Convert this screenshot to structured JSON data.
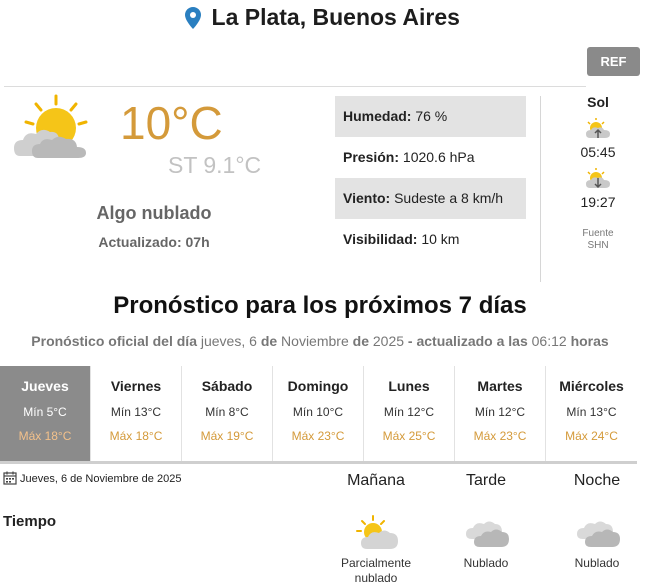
{
  "location": {
    "city": "La Plata, Buenos Aires",
    "icon": "map-pin-icon"
  },
  "ref_button": {
    "label": "REF"
  },
  "current": {
    "icon": "partly-cloudy-icon",
    "temperature": "10°C",
    "feels_like": "ST 9.1°C",
    "description": "Algo nublado",
    "updated": "Actualizado: 07h"
  },
  "details": [
    {
      "label": "Humedad:",
      "value": "76 %"
    },
    {
      "label": "Presión:",
      "value": "1020.6 hPa"
    },
    {
      "label": "Viento:",
      "value": "Sudeste a 8 km/h"
    },
    {
      "label": "Visibilidad:",
      "value": "10 km"
    }
  ],
  "sun": {
    "title": "Sol",
    "sunrise": "05:45",
    "sunset": "19:27",
    "source_label": "Fuente",
    "source": "SHN"
  },
  "forecast": {
    "title": "Pronóstico para los próximos 7 días",
    "subtitle": {
      "p1": "Pronóstico oficial del día",
      "weekday": "jueves, 6",
      "p2": "de",
      "month": "Noviembre",
      "p3": "de",
      "year": "2025",
      "p4": "- actualizado a las",
      "time": "06:12",
      "p5": "horas"
    },
    "days": [
      {
        "name": "Jueves",
        "min": "Mín 5°C",
        "max": "Máx 18°C",
        "active": true
      },
      {
        "name": "Viernes",
        "min": "Mín 13°C",
        "max": "Máx 18°C",
        "active": false
      },
      {
        "name": "Sábado",
        "min": "Mín 8°C",
        "max": "Máx 19°C",
        "active": false
      },
      {
        "name": "Domingo",
        "min": "Mín 10°C",
        "max": "Máx 23°C",
        "active": false
      },
      {
        "name": "Lunes",
        "min": "Mín 12°C",
        "max": "Máx 25°C",
        "active": false
      },
      {
        "name": "Martes",
        "min": "Mín 12°C",
        "max": "Máx 23°C",
        "active": false
      },
      {
        "name": "Miércoles",
        "min": "Mín 13°C",
        "max": "Máx 24°C",
        "active": false
      }
    ]
  },
  "detail_day": {
    "date": "Jueves, 6 de Noviembre de 2025",
    "row_label": "Tiempo",
    "periods": [
      {
        "name": "Mañana",
        "icon": "partly-cloudy-icon",
        "description": "Parcialmente nublado"
      },
      {
        "name": "Tarde",
        "icon": "cloudy-icon",
        "description": "Nublado"
      },
      {
        "name": "Noche",
        "icon": "cloudy-icon",
        "description": "Nublado"
      }
    ]
  },
  "colors": {
    "accent_temp": "#d49a3a",
    "active_day_bg": "#8b8b8b",
    "shade_row": "#e3e3e3",
    "pin": "#2a7fc0"
  }
}
